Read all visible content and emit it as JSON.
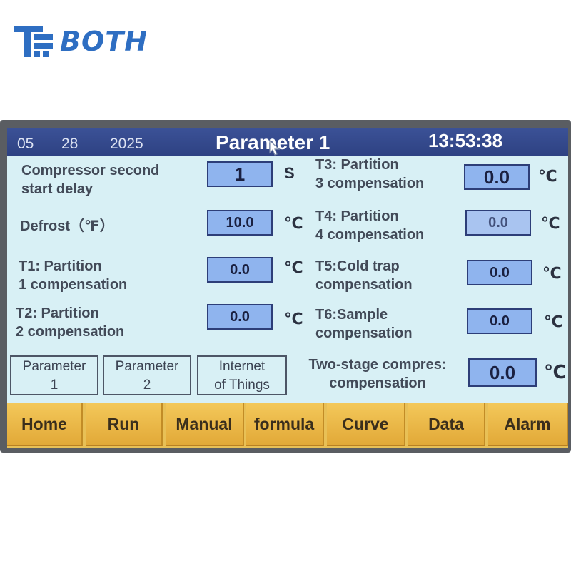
{
  "brand": {
    "name": "BOTH",
    "color": "#2e6ec2"
  },
  "header": {
    "month": "05",
    "day": "28",
    "year": "2025",
    "title": "Parameter 1",
    "time": "13:53:38"
  },
  "params_left": [
    {
      "label": "Compressor second\nstart delay",
      "value": "1",
      "unit": "S"
    },
    {
      "label": "Defrost（℉）",
      "value": "10.0",
      "unit": "℃"
    },
    {
      "label": "T1: Partition\n1 compensation",
      "value": "0.0",
      "unit": "℃"
    },
    {
      "label": "T2: Partition\n2 compensation",
      "value": "0.0",
      "unit": "℃"
    }
  ],
  "params_right": [
    {
      "label": "T3: Partition\n3 compensation",
      "value": "0.0",
      "unit": "℃"
    },
    {
      "label": "T4: Partition\n4 compensation",
      "value": "0.0",
      "unit": "℃"
    },
    {
      "label": "T5:Cold trap\n compensation",
      "value": "0.0",
      "unit": "℃"
    },
    {
      "label": "T6:Sample\ncompensation",
      "value": "0.0",
      "unit": "℃"
    },
    {
      "label": "Two-stage compres:\ncompensation",
      "value": "0.0",
      "unit": "℃"
    }
  ],
  "subnav": [
    {
      "label": "Parameter\n1"
    },
    {
      "label": "Parameter\n2"
    },
    {
      "label": "Internet\nof Things"
    }
  ],
  "nav": [
    {
      "label": "Home"
    },
    {
      "label": "Run"
    },
    {
      "label": "Manual"
    },
    {
      "label": "formula"
    },
    {
      "label": "Curve"
    },
    {
      "label": "Data"
    },
    {
      "label": "Alarm"
    }
  ]
}
